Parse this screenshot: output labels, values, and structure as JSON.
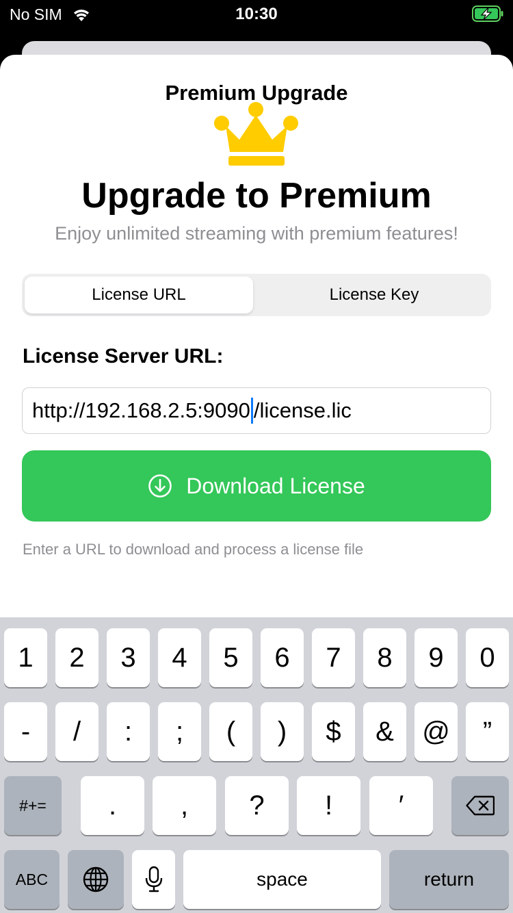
{
  "status": {
    "carrier": "No SIM",
    "time": "10:30"
  },
  "sheet": {
    "nav_title": "Premium Upgrade",
    "headline": "Upgrade to Premium",
    "subtitle": "Enjoy unlimited streaming with premium features!",
    "tabs": [
      {
        "label": "License URL",
        "selected": true
      },
      {
        "label": "License Key",
        "selected": false
      }
    ],
    "field_label": "License Server URL:",
    "url_value_before_caret": "http://192.168.2.5:9090",
    "url_value_after_caret": "/license.lic",
    "download_label": "Download License",
    "hint": "Enter a URL to download and process a license file"
  },
  "keyboard": {
    "row1": [
      "1",
      "2",
      "3",
      "4",
      "5",
      "6",
      "7",
      "8",
      "9",
      "0"
    ],
    "row2": [
      "-",
      "/",
      ":",
      ";",
      "(",
      ")",
      "$",
      "&",
      "@",
      "”"
    ],
    "row3_left": "#+=",
    "row3": [
      ".",
      ",",
      "?",
      "!",
      "′"
    ],
    "abc": "ABC",
    "space": "space",
    "return": "return"
  },
  "colors": {
    "accent_green": "#34c759",
    "caret_blue": "#0a7aff",
    "crown_yellow": "#ffcc00"
  },
  "icons": [
    "wifi-icon",
    "battery-charging-icon",
    "crown-icon",
    "download-circle-icon",
    "delete-icon",
    "globe-icon",
    "microphone-icon"
  ]
}
